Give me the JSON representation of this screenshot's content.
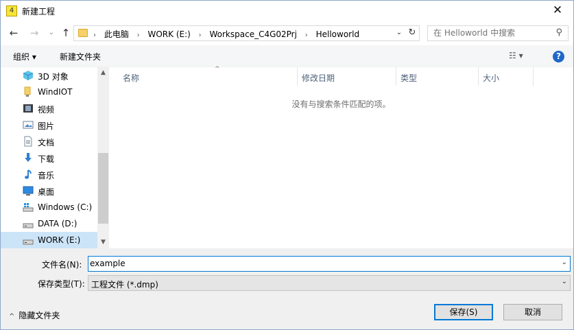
{
  "window": {
    "title": "新建工程",
    "app_icon_text": "4"
  },
  "nav": {
    "breadcrumbs": [
      "此电脑",
      "WORK (E:)",
      "Workspace_C4G02Prj",
      "Helloworld"
    ],
    "search_placeholder": "在 Helloworld 中搜索"
  },
  "toolbar": {
    "organize_label": "组织 ▾",
    "new_folder_label": "新建文件夹",
    "view_label": "☷ ▾",
    "help_label": "?"
  },
  "sidebar": {
    "items": [
      {
        "label": "3D 对象",
        "icon": "cube-icon"
      },
      {
        "label": "WindIOT",
        "icon": "folder-icon"
      },
      {
        "label": "视频",
        "icon": "video-icon"
      },
      {
        "label": "图片",
        "icon": "picture-icon"
      },
      {
        "label": "文档",
        "icon": "document-icon"
      },
      {
        "label": "下载",
        "icon": "download-icon"
      },
      {
        "label": "音乐",
        "icon": "music-icon"
      },
      {
        "label": "桌面",
        "icon": "desktop-icon"
      },
      {
        "label": "Windows  (C:)",
        "icon": "drive-windows-icon"
      },
      {
        "label": "DATA (D:)",
        "icon": "drive-icon"
      },
      {
        "label": "WORK (E:)",
        "icon": "drive-icon",
        "selected": true
      }
    ]
  },
  "list": {
    "columns": [
      "名称",
      "修改日期",
      "类型",
      "大小"
    ],
    "empty_message": "没有与搜索条件匹配的项。"
  },
  "form": {
    "filename_label": "文件名(N):",
    "filename_value": "example",
    "filetype_label": "保存类型(T):",
    "filetype_value": "工程文件 (*.dmp)"
  },
  "footer": {
    "hide_folders_label": "隐藏文件夹",
    "save_label": "保存(S)",
    "cancel_label": "取消"
  },
  "colors": {
    "accent": "#0078d7",
    "selected_bg": "#cce4f7"
  }
}
